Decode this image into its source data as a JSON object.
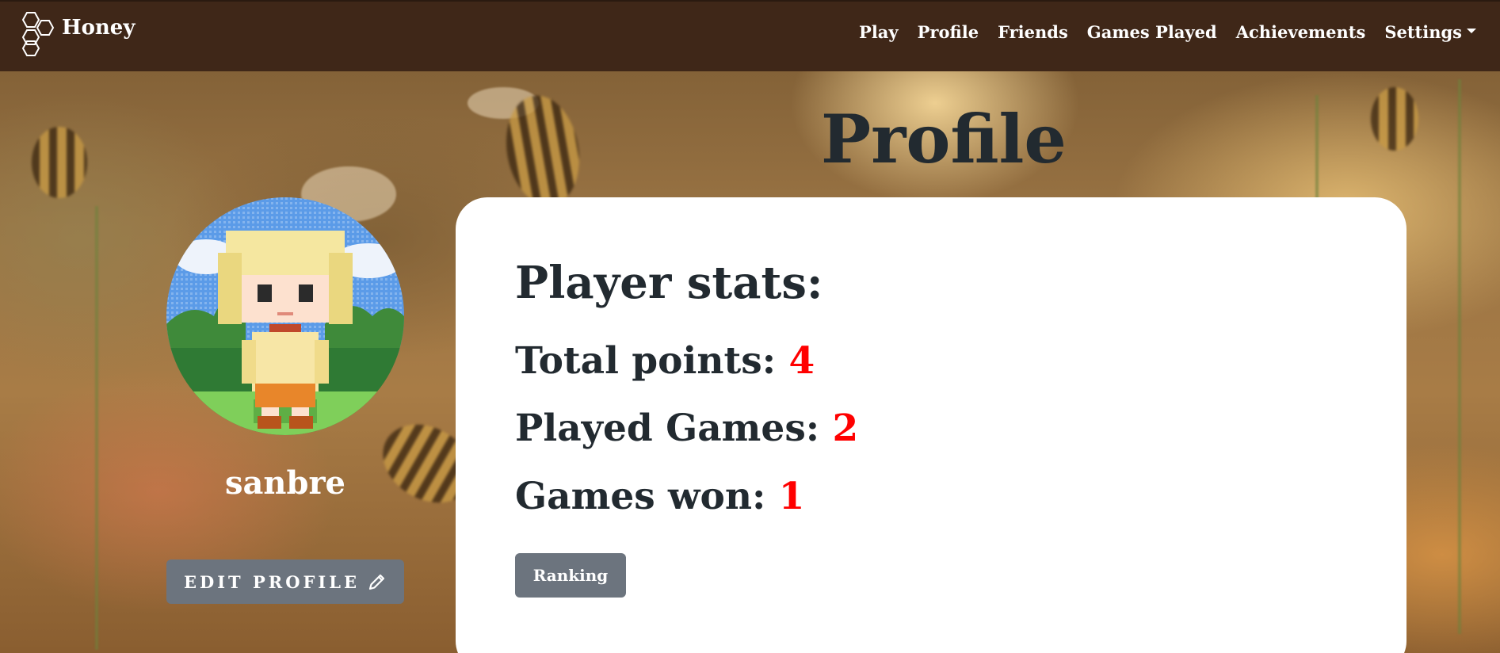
{
  "navbar": {
    "brand": "Honey",
    "links": [
      "Play",
      "Profile",
      "Friends",
      "Games Played",
      "Achievements"
    ],
    "settings_label": "Settings"
  },
  "page": {
    "title": "Profile"
  },
  "profile": {
    "username": "sanbre",
    "edit_label": "EDIT PROFILE"
  },
  "stats": {
    "heading": "Player stats:",
    "total_points_label": "Total points: ",
    "total_points": "4",
    "played_games_label": "Played Games: ",
    "played_games": "2",
    "games_won_label": "Games won: ",
    "games_won": "1",
    "ranking_label": "Ranking"
  },
  "colors": {
    "navbar": "#3f2718",
    "button": "#6c747e",
    "stat_value": "#ff0000",
    "text_dark": "#222a30"
  }
}
